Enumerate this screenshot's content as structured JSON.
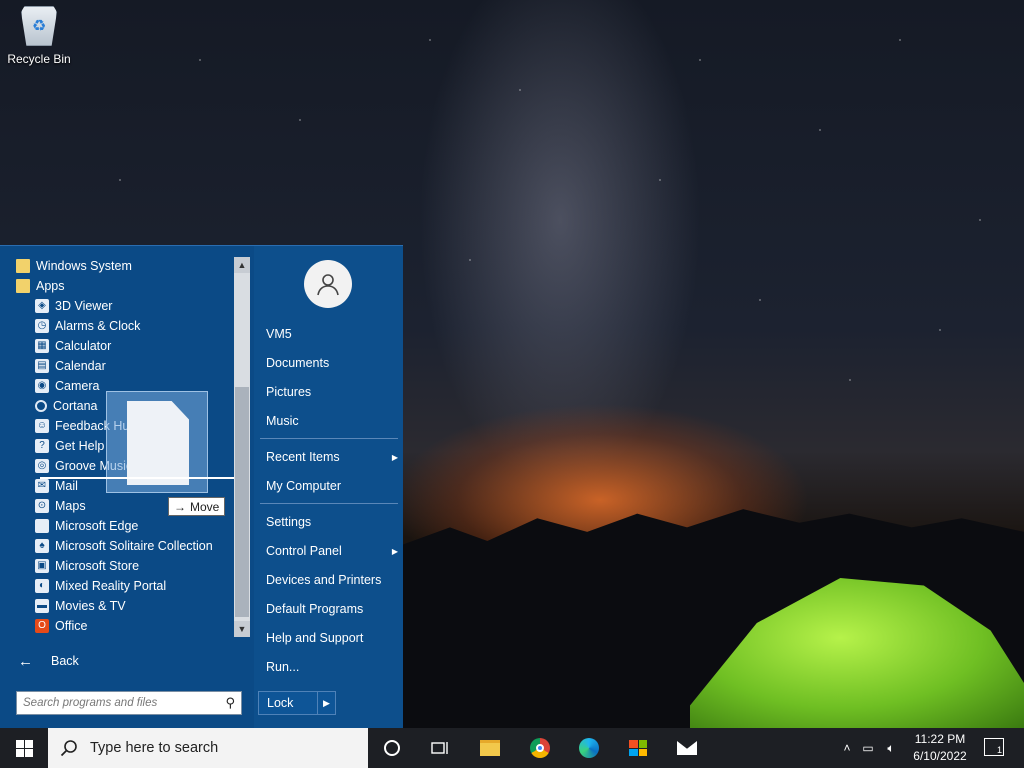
{
  "desktop": {
    "recycle_bin_label": "Recycle Bin"
  },
  "start_menu": {
    "programs": [
      {
        "label": "Windows System",
        "icon": "folder-icon",
        "child": false
      },
      {
        "label": "Apps",
        "icon": "folder-icon",
        "child": false
      },
      {
        "label": "3D Viewer",
        "icon": "cube-icon",
        "child": true
      },
      {
        "label": "Alarms & Clock",
        "icon": "alarm-clock-icon",
        "child": true
      },
      {
        "label": "Calculator",
        "icon": "calculator-icon",
        "child": true
      },
      {
        "label": "Calendar",
        "icon": "calendar-icon",
        "child": true
      },
      {
        "label": "Camera",
        "icon": "camera-icon",
        "child": true
      },
      {
        "label": "Cortana",
        "icon": "cortana-icon",
        "child": true
      },
      {
        "label": "Feedback Hub",
        "icon": "feedback-icon",
        "child": true
      },
      {
        "label": "Get Help",
        "icon": "help-icon",
        "child": true
      },
      {
        "label": "Groove Music",
        "icon": "music-disc-icon",
        "child": true
      },
      {
        "label": "Mail",
        "icon": "mail-icon",
        "child": true
      },
      {
        "label": "Maps",
        "icon": "map-icon",
        "child": true
      },
      {
        "label": "Microsoft Edge",
        "icon": "document-icon",
        "child": true
      },
      {
        "label": "Microsoft Solitaire Collection",
        "icon": "cards-icon",
        "child": true
      },
      {
        "label": "Microsoft Store",
        "icon": "store-icon",
        "child": true
      },
      {
        "label": "Mixed Reality Portal",
        "icon": "headset-icon",
        "child": true
      },
      {
        "label": "Movies & TV",
        "icon": "film-icon",
        "child": true
      },
      {
        "label": "Office",
        "icon": "office-icon",
        "child": true
      }
    ],
    "back_label": "Back",
    "search_placeholder": "Search programs and files",
    "drag_tooltip": "Move",
    "right_items": {
      "user": "VM5",
      "documents": "Documents",
      "pictures": "Pictures",
      "music": "Music",
      "recent_items": "Recent Items",
      "my_computer": "My Computer",
      "settings": "Settings",
      "control_panel": "Control Panel",
      "devices_printers": "Devices and Printers",
      "default_programs": "Default Programs",
      "help_support": "Help and Support",
      "run": "Run..."
    },
    "lock_label": "Lock"
  },
  "taskbar": {
    "search_placeholder": "Type here to search",
    "time": "11:22 PM",
    "date": "6/10/2022",
    "notification_count": "1"
  },
  "colors": {
    "start_menu_bg": "#0d4f8c",
    "taskbar_bg": "#1d1f24"
  }
}
